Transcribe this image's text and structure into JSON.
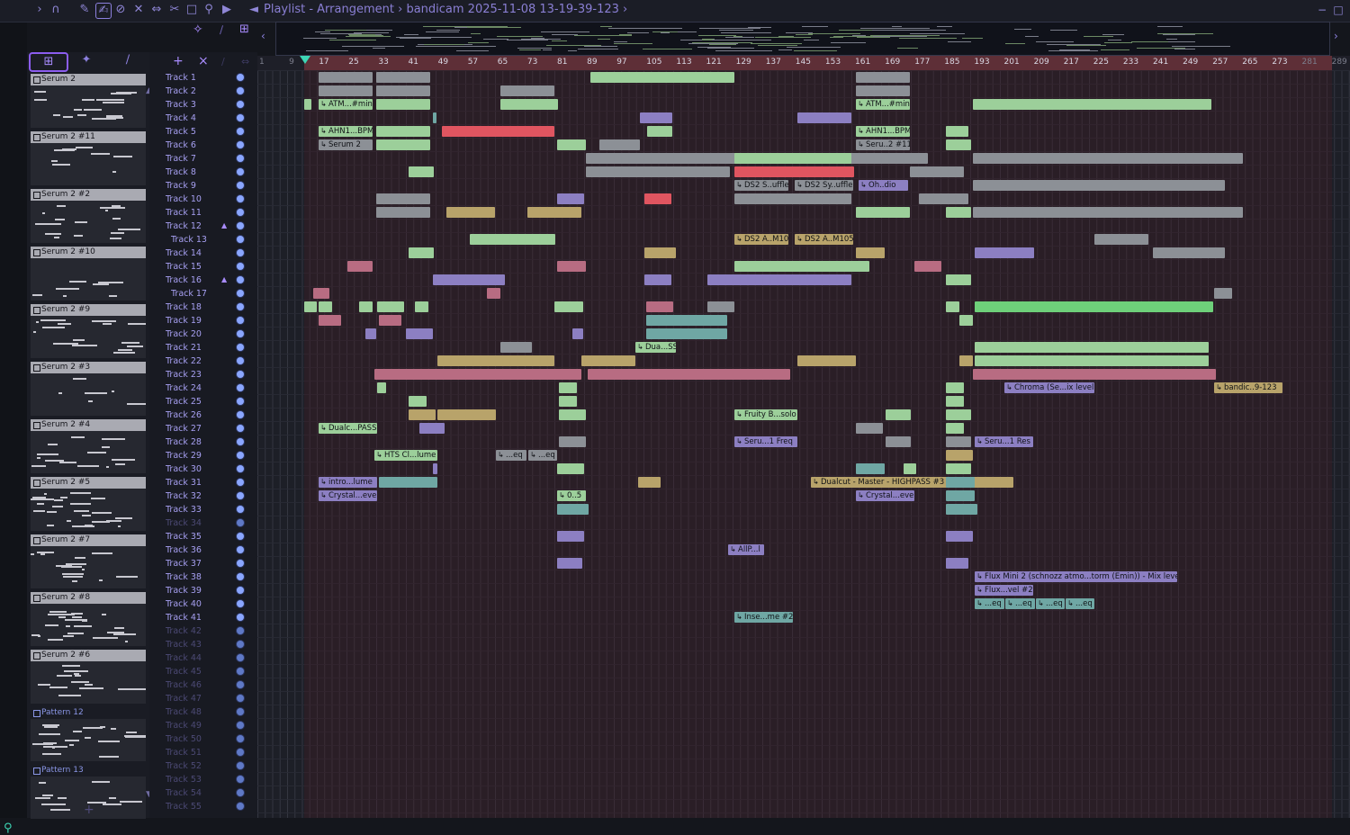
{
  "titlebar": {
    "title": "Playlist - Arrangement",
    "breadcrumb_sep": "›",
    "file": "bandicam 2025-11-08 13-19-39-123",
    "trailing_sep": "›",
    "icons": [
      "play-arrow-icon",
      "magnet-icon",
      "pencil-icon",
      "brush-icon",
      "delete-icon",
      "mute-icon",
      "slip-icon",
      "slice-icon",
      "select-icon",
      "zoom-icon",
      "playback-icon",
      "speaker-icon"
    ]
  },
  "picker": {
    "toolbar_icons": [
      "pattern-picker-icon",
      "audio-picker-icon",
      "automation-picker-icon"
    ],
    "patterns": [
      {
        "name": "Serum 2"
      },
      {
        "name": "Serum 2 #11"
      },
      {
        "name": "Serum 2 #2"
      },
      {
        "name": "Serum 2 #10"
      },
      {
        "name": "Serum 2 #9"
      },
      {
        "name": "Serum 2 #3"
      },
      {
        "name": "Serum 2 #4"
      },
      {
        "name": "Serum 2 #5"
      },
      {
        "name": "Serum 2 #7"
      },
      {
        "name": "Serum 2 #8"
      },
      {
        "name": "Serum 2 #6"
      },
      {
        "name": "Pattern 12"
      },
      {
        "name": "Pattern 13"
      }
    ]
  },
  "ruler": {
    "ticks": [
      "1",
      "9",
      "17",
      "25",
      "33",
      "41",
      "49",
      "57",
      "65",
      "73",
      "81",
      "89",
      "97",
      "105",
      "113",
      "121",
      "129",
      "137",
      "145",
      "153",
      "161",
      "169",
      "177",
      "185",
      "193",
      "201",
      "209",
      "217",
      "225",
      "233",
      "241",
      "249",
      "257",
      "265",
      "273",
      "281",
      "289"
    ]
  },
  "tracks": [
    "Track 1",
    "Track 2",
    "Track 3",
    "Track 4",
    "Track 5",
    "Track 6",
    "Track 7",
    "Track 8",
    "Track 9",
    "Track 10",
    "Track 11",
    "Track 12",
    "Track 13",
    "Track 14",
    "Track 15",
    "Track 16",
    "Track 17",
    "Track 18",
    "Track 19",
    "Track 20",
    "Track 21",
    "Track 22",
    "Track 23",
    "Track 24",
    "Track 25",
    "Track 26",
    "Track 27",
    "Track 28",
    "Track 29",
    "Track 30",
    "Track 31",
    "Track 32",
    "Track 33",
    "Track 34",
    "Track 35",
    "Track 36",
    "Track 37",
    "Track 38",
    "Track 39",
    "Track 40",
    "Track 41",
    "Track 42",
    "Track 43",
    "Track 44",
    "Track 45",
    "Track 46",
    "Track 47",
    "Track 48",
    "Track 49",
    "Track 50",
    "Track 51",
    "Track 52",
    "Track 53",
    "Track 54",
    "Track 55"
  ],
  "dim_tracks": [
    "Track 34",
    "Track 42",
    "Track 43",
    "Track 44",
    "Track 45",
    "Track 46",
    "Track 47",
    "Track 48",
    "Track 49",
    "Track 50",
    "Track 51",
    "Track 52",
    "Track 53",
    "Track 54",
    "Track 55"
  ],
  "clip_labels": {
    "t3": "ATM...#min",
    "t3b": "ATM...#min",
    "t5": "AHN1...BPM",
    "t5b": "AHN1...BPM",
    "t6": "Serum 2",
    "t6b": "Seru..2 #11",
    "t9a": "DS2 S..uffle",
    "t9b": "DS2 Sy..uffle",
    "t9c": "Oh..dio",
    "t13a": "DS2 A..M105",
    "t13b": "DS2 A..M105",
    "t20": "Dua...SS",
    "t24": "Chroma (Se...ix level",
    "t24b": "bandic..9-123",
    "t26": "Fruity B...solo",
    "t27": "Dualc...PASS",
    "t28a": "Seru...1 Freq",
    "t28b": "Seru...1 Res",
    "t29": "HTS Cl...lume",
    "t29b": "...eq",
    "t29c": "...eq",
    "t31a": "intro...lume",
    "t31b": "Dualcut - Master - HIGHPASS #3",
    "t32a": "Crystal...evel",
    "t32b": "Crystal...evel",
    "t32c": "0..5",
    "t36": "AllP...l",
    "t38": "Flux Mini 2 (schnozz atmo...torm (Emin)) - Mix level",
    "t39": "Flux...vel #2",
    "t40a": "...eq",
    "t40b": "...eq",
    "t40c": "...eq",
    "t40d": "...eq",
    "t41": "Inse...me #2"
  },
  "colors": {
    "green_clip": "#9ccf9a",
    "gray_clip": "#8c9096",
    "red_clip": "#e05560",
    "purple_clip": "#8c7fc2",
    "olive_clip": "#b8a36a",
    "teal_clip": "#6fa7a4",
    "bright_green": "#6ed07a",
    "pink_clip": "#b86c82",
    "ruler_red": "#5e2f37",
    "accent": "#8c5df0",
    "playhead": "#3dd6b5"
  }
}
